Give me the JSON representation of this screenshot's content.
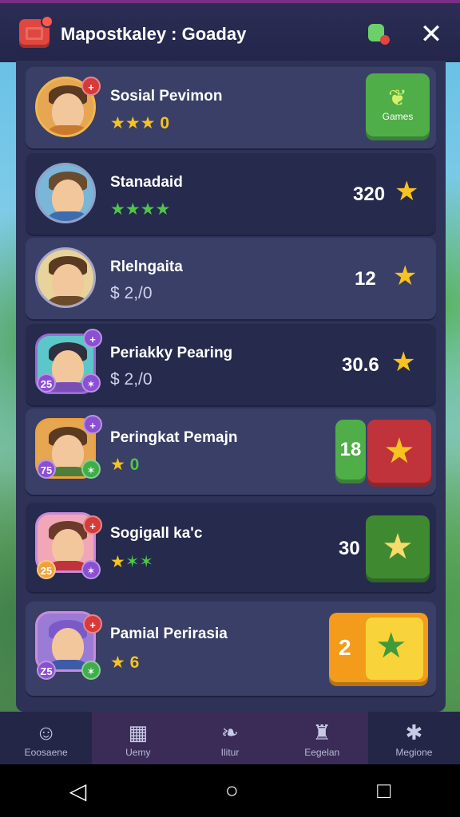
{
  "header": {
    "title": "Mapostkaley : Goaday",
    "close_label": "✕"
  },
  "rows": [
    {
      "name": "Sosial Pevimon",
      "sub_stars": "★★★",
      "sub_value": "0",
      "action_label": "Games"
    },
    {
      "name": "Stanadaid",
      "sub_stars": "★★★★",
      "score": "320"
    },
    {
      "name": "Rlelngaita",
      "sub_value": "$ 2,/0",
      "score": "12"
    },
    {
      "name": "Periakky Pearing",
      "sub_value": "$ 2,/0",
      "score": "30.6"
    },
    {
      "name": "Peringkat Pemajn",
      "sub_stars": "★",
      "sub_value": "0",
      "score": "18"
    },
    {
      "name": "Sogigall ka'c",
      "sub_stars": "★✶✶",
      "score": "30"
    },
    {
      "name": "Pamial Perirasia",
      "sub_stars": "★",
      "sub_value": "6",
      "score": "2"
    }
  ],
  "badges": {
    "plus": "+",
    "left_a": "25",
    "left_b": "75",
    "left_c": "Z5",
    "right_x": "✶"
  },
  "nav": [
    {
      "label": "Eoosaene"
    },
    {
      "label": "Uemy"
    },
    {
      "label": "Ilitur"
    },
    {
      "label": "Eegelan"
    },
    {
      "label": "Megione"
    }
  ],
  "colors": {
    "accent_green": "#4fae48",
    "accent_red": "#c0333a",
    "accent_orange": "#f39b1b",
    "star_yellow": "#f6c31f"
  }
}
